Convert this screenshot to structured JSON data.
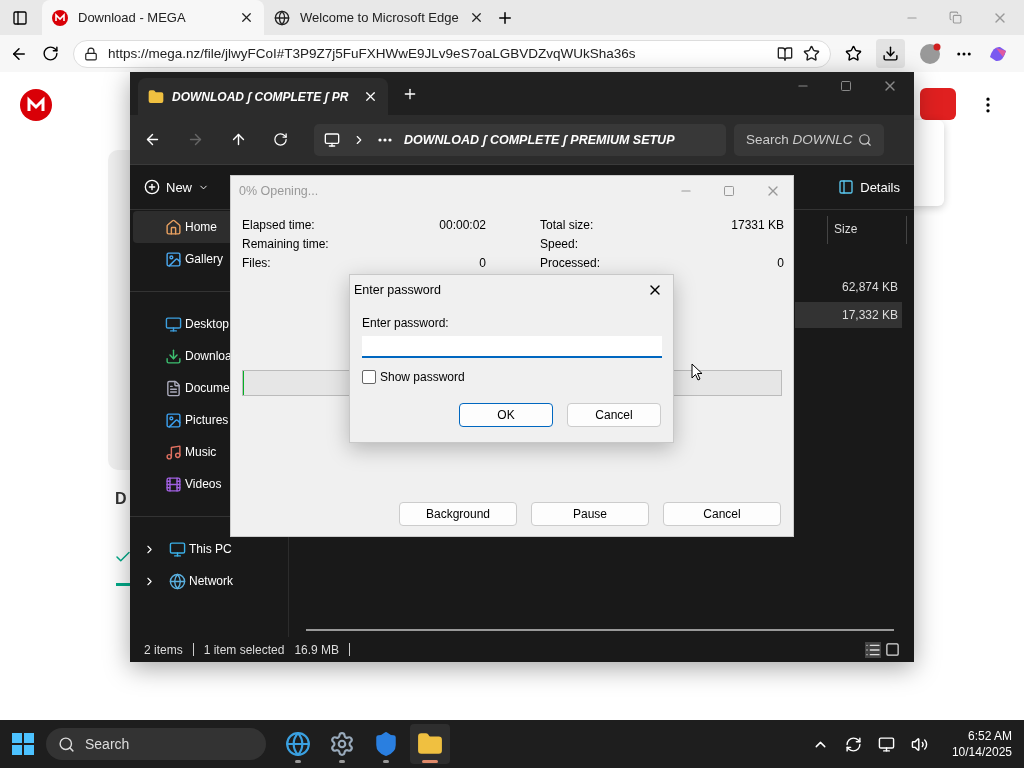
{
  "browser": {
    "tabs": [
      {
        "title": "Download - MEGA",
        "selected": true
      },
      {
        "title": "Welcome to Microsoft Edge",
        "selected": false
      }
    ],
    "url": "https://mega.nz/file/jlwyFCoI#T3P9Z7j5FuFXHWwE9JLv9eS7oaLGBVDZvqWUkSha36s"
  },
  "page": {
    "heading": "D"
  },
  "explorer": {
    "tab_title": "DOWNLOAD ʃ COMPLETE ʃ PR",
    "breadcrumb": "DOWNLOAD ʃ COMPLETE ʃ PREMIUM SETUP",
    "search": {
      "placeholder": "Search *DOWNLC*"
    },
    "commands": {
      "new": "New",
      "details": "Details"
    },
    "sidebar": [
      [
        {
          "label": "Home",
          "selected": true
        },
        {
          "label": "Gallery",
          "selected": false
        }
      ],
      [
        {
          "label": "Desktop",
          "selected": false
        },
        {
          "label": "Downloa",
          "selected": false
        },
        {
          "label": "Docume",
          "selected": false
        },
        {
          "label": "Pictures",
          "selected": false
        },
        {
          "label": "Music",
          "selected": false
        },
        {
          "label": "Videos",
          "selected": false
        }
      ],
      [
        {
          "label": "This PC",
          "selected": false,
          "expanded": false
        },
        {
          "label": "Network",
          "selected": false,
          "expanded": false
        }
      ]
    ],
    "columns": [
      "Size"
    ],
    "rows": [
      {
        "size": "62,874 KB",
        "selected": false
      },
      {
        "size": "17,332 KB",
        "selected": true
      }
    ],
    "status": {
      "items": "2 items",
      "selection": "1 item selected",
      "size": "16.9 MB"
    }
  },
  "progress": {
    "title": "0% Opening...",
    "left": [
      {
        "label": "Elapsed time:",
        "value": "00:00:02"
      },
      {
        "label": "Remaining time:"
      },
      {
        "label": "Files:",
        "value": "0"
      }
    ],
    "right": [
      {
        "label": "Total size:",
        "value": "17331 KB"
      },
      {
        "label": "Speed:"
      },
      {
        "label": "Processed:",
        "value": "0"
      }
    ],
    "level": 0,
    "buttons": [
      "Background",
      "Pause",
      "Cancel"
    ]
  },
  "password": {
    "title": "Enter password",
    "label": "Enter password:",
    "show_password": {
      "label": "Show password",
      "checked": false
    },
    "buttons": [
      {
        "label": "OK",
        "default": true
      },
      {
        "label": "Cancel",
        "default": false
      }
    ]
  },
  "taskbar": {
    "search": {
      "placeholder": "Search"
    },
    "apps": [
      {
        "kind": "edge",
        "active": false
      },
      {
        "kind": "settings",
        "active": false
      },
      {
        "kind": "defender",
        "active": false
      },
      {
        "kind": "explorer",
        "active": true
      }
    ],
    "time": "6:52 AM",
    "date": "10/14/2025"
  }
}
